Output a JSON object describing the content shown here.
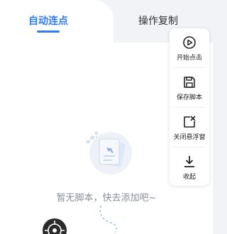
{
  "tabs": [
    {
      "label": "自动连点"
    },
    {
      "label": "操作复制"
    }
  ],
  "empty_state": {
    "message": "暂无脚本，快去添加吧~"
  },
  "side_menu": [
    {
      "label": "开始点击",
      "icon": "play-icon"
    },
    {
      "label": "保存脚本",
      "icon": "save-icon"
    },
    {
      "label": "关闭悬浮窗",
      "icon": "close-window-icon"
    },
    {
      "label": "收起",
      "icon": "collapse-download-icon"
    }
  ],
  "colors": {
    "accent": "#2f7cf6",
    "background": "#f2f3f7",
    "panel": "#ffffff",
    "text_dark": "#222222",
    "text_muted": "#8a8f99"
  }
}
